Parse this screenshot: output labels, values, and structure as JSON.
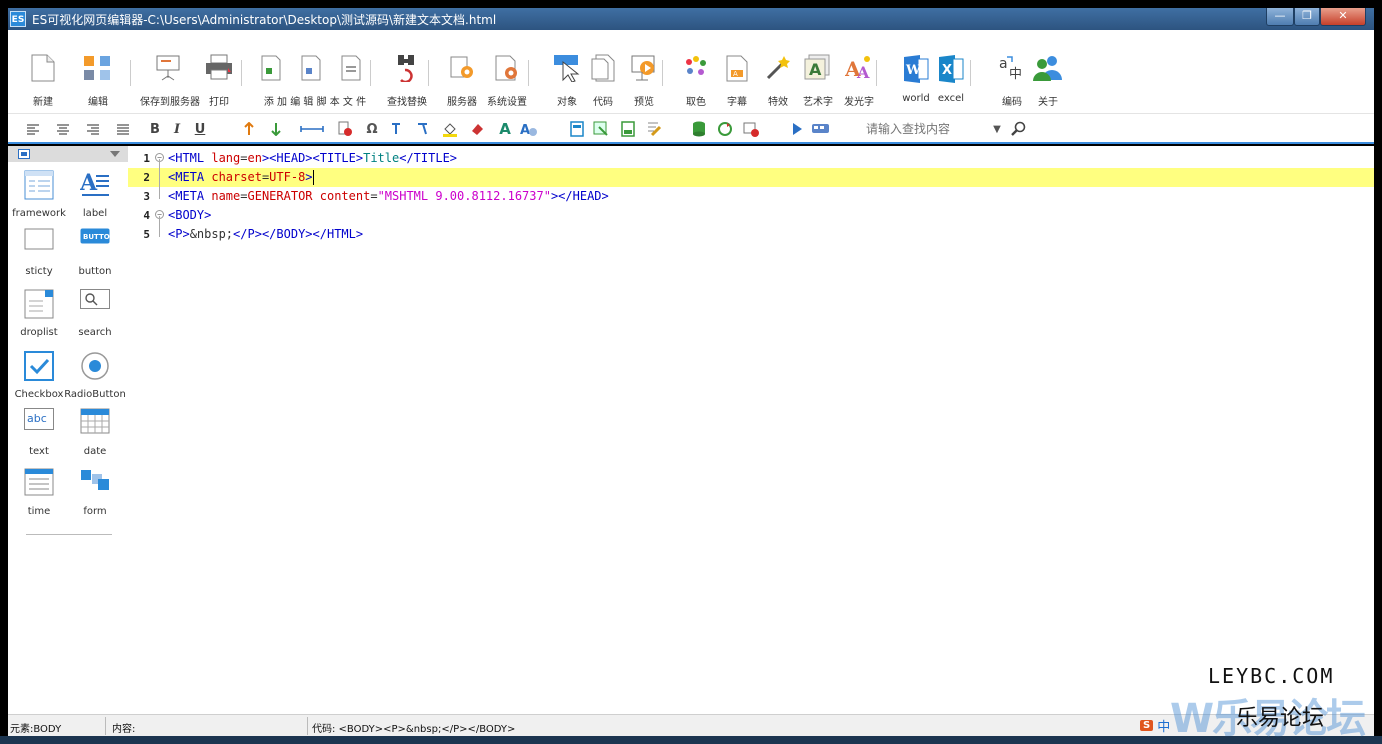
{
  "window": {
    "app_icon": "ES",
    "title": "ES可视化网页编辑器-C:\\Users\\Administrator\\Desktop\\测试源码\\新建文本文档.html",
    "min": "—",
    "max": "❐",
    "close": "✕"
  },
  "toolbar": [
    {
      "name": "new-button",
      "label": "新建",
      "icon": "new-file-icon"
    },
    {
      "name": "edit-button",
      "label": "编辑",
      "icon": "edit-icon"
    },
    {
      "name": "save-to-server-button",
      "label": "保存到服务器",
      "icon": "presentation-icon"
    },
    {
      "name": "print-button",
      "label": "打印",
      "icon": "printer-icon"
    },
    {
      "name": "add-edit-script-button",
      "label": "添 加 编 辑 脚 本 文 件",
      "icon": "script-file-icon"
    },
    {
      "name": "find-replace-button",
      "label": "查找替换",
      "icon": "binoculars-icon"
    },
    {
      "name": "server-button",
      "label": "服务器",
      "icon": "server-gear-icon"
    },
    {
      "name": "system-settings-button",
      "label": "系统设置",
      "icon": "settings-icon"
    },
    {
      "name": "object-button",
      "label": "对象",
      "icon": "cursor-icon"
    },
    {
      "name": "code-button",
      "label": "代码",
      "icon": "code-icon"
    },
    {
      "name": "preview-button",
      "label": "预览",
      "icon": "preview-icon"
    },
    {
      "name": "color-pick-button",
      "label": "取色",
      "icon": "palette-icon"
    },
    {
      "name": "subtitle-button",
      "label": "字幕",
      "icon": "subtitle-icon"
    },
    {
      "name": "effects-button",
      "label": "特效",
      "icon": "magic-wand-icon"
    },
    {
      "name": "art-text-button",
      "label": "艺术字",
      "icon": "art-text-icon"
    },
    {
      "name": "glow-text-button",
      "label": "发光字",
      "icon": "glow-text-icon"
    },
    {
      "name": "word-button",
      "label": "world",
      "icon": "word-icon"
    },
    {
      "name": "excel-button",
      "label": "excel",
      "icon": "excel-icon"
    },
    {
      "name": "encoding-button",
      "label": "编码",
      "icon": "translate-icon"
    },
    {
      "name": "about-button",
      "label": "关于",
      "icon": "users-icon"
    }
  ],
  "format_bar": {
    "bold": "B",
    "italic": "I",
    "underline": "U",
    "omega": "Ω",
    "font_a": "A",
    "search_placeholder": "请输入查找内容",
    "dropdown": "▼"
  },
  "components": [
    {
      "name": "component-framework",
      "label": "framework",
      "icon": "framework-icon"
    },
    {
      "name": "component-label",
      "label": "label",
      "icon": "label-icon"
    },
    {
      "name": "component-sticty",
      "label": "sticty",
      "icon": "sticky-icon"
    },
    {
      "name": "component-button",
      "label": "button",
      "icon": "button-icon",
      "icon_text": "BUTTON"
    },
    {
      "name": "component-droplist",
      "label": "droplist",
      "icon": "droplist-icon"
    },
    {
      "name": "component-search",
      "label": "search",
      "icon": "search-icon"
    },
    {
      "name": "component-checkbox",
      "label": "Checkbox",
      "icon": "checkbox-icon"
    },
    {
      "name": "component-radiobutton",
      "label": "RadioButton",
      "icon": "radio-icon"
    },
    {
      "name": "component-text",
      "label": "text",
      "icon": "text-icon",
      "icon_text": "abc"
    },
    {
      "name": "component-date",
      "label": "date",
      "icon": "calendar-icon"
    },
    {
      "name": "component-time",
      "label": "time",
      "icon": "time-icon"
    },
    {
      "name": "component-form",
      "label": "form",
      "icon": "form-icon"
    }
  ],
  "editor": {
    "line_numbers": [
      "1",
      "2",
      "3",
      "4",
      "5"
    ],
    "lines": [
      [
        {
          "t": "tag",
          "v": "<HTML "
        },
        {
          "t": "attr",
          "v": "lang"
        },
        {
          "t": "plain",
          "v": "="
        },
        {
          "t": "attr",
          "v": "en"
        },
        {
          "t": "tag",
          "v": "><HEAD><TITLE>"
        },
        {
          "t": "txt",
          "v": "Title"
        },
        {
          "t": "tag",
          "v": "</TITLE>"
        }
      ],
      [
        {
          "t": "tag",
          "v": "<META "
        },
        {
          "t": "attr",
          "v": "charset"
        },
        {
          "t": "plain",
          "v": "="
        },
        {
          "t": "attr",
          "v": "UTF-8"
        },
        {
          "t": "tag",
          "v": ">"
        }
      ],
      [
        {
          "t": "tag",
          "v": "<META "
        },
        {
          "t": "attr",
          "v": "name"
        },
        {
          "t": "plain",
          "v": "="
        },
        {
          "t": "attr",
          "v": "GENERATOR "
        },
        {
          "t": "attr",
          "v": "content"
        },
        {
          "t": "plain",
          "v": "="
        },
        {
          "t": "val",
          "v": "\"MSHTML 9.00.8112.16737\""
        },
        {
          "t": "tag",
          "v": "></HEAD>"
        }
      ],
      [
        {
          "t": "tag",
          "v": "<BODY>"
        }
      ],
      [
        {
          "t": "tag",
          "v": "<P>"
        },
        {
          "t": "plain",
          "v": "&nbsp;"
        },
        {
          "t": "tag",
          "v": "</P></BODY></HTML>"
        }
      ]
    ]
  },
  "status": {
    "element": "元素:BODY",
    "content": "内容:",
    "code": "代码:  <BODY><P>&nbsp;</P></BODY>"
  },
  "ime": {
    "logo": "S",
    "lang": "中"
  },
  "watermark": {
    "url": "LEYBC.COM",
    "logo": "W乐易论坛",
    "name": "乐易论坛"
  }
}
